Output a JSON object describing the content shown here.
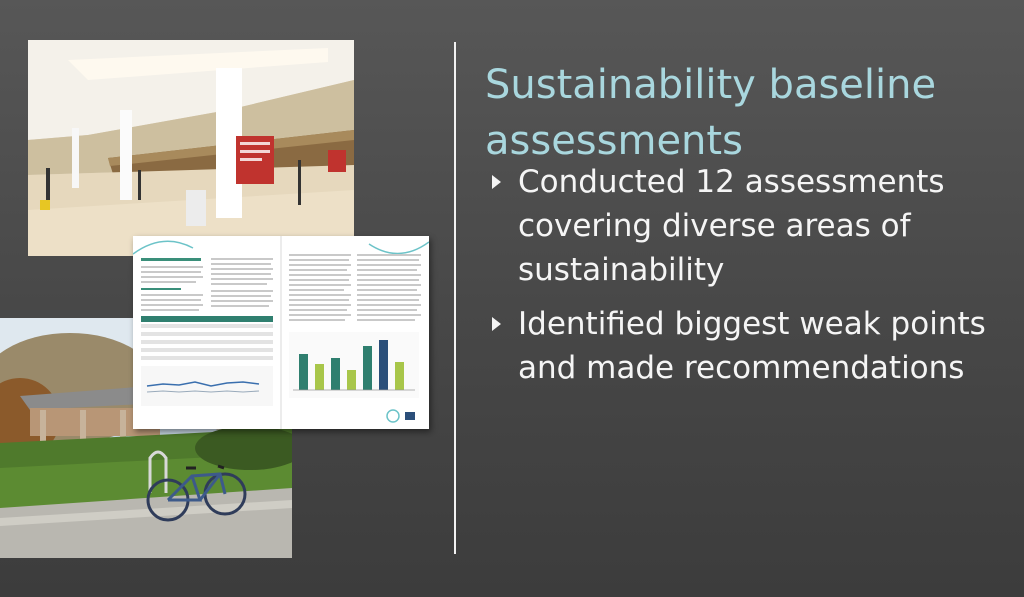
{
  "slide": {
    "title_line1": "Sustainability baseline",
    "title_line2": "assessments",
    "bullets": [
      "Conducted 12 assessments covering diverse areas of sustainability",
      "Identified biggest weak points and made recommendations"
    ]
  },
  "colors": {
    "title": "#a9d7de",
    "body_text": "#f5f5f5",
    "background": "#4a4a4a"
  }
}
